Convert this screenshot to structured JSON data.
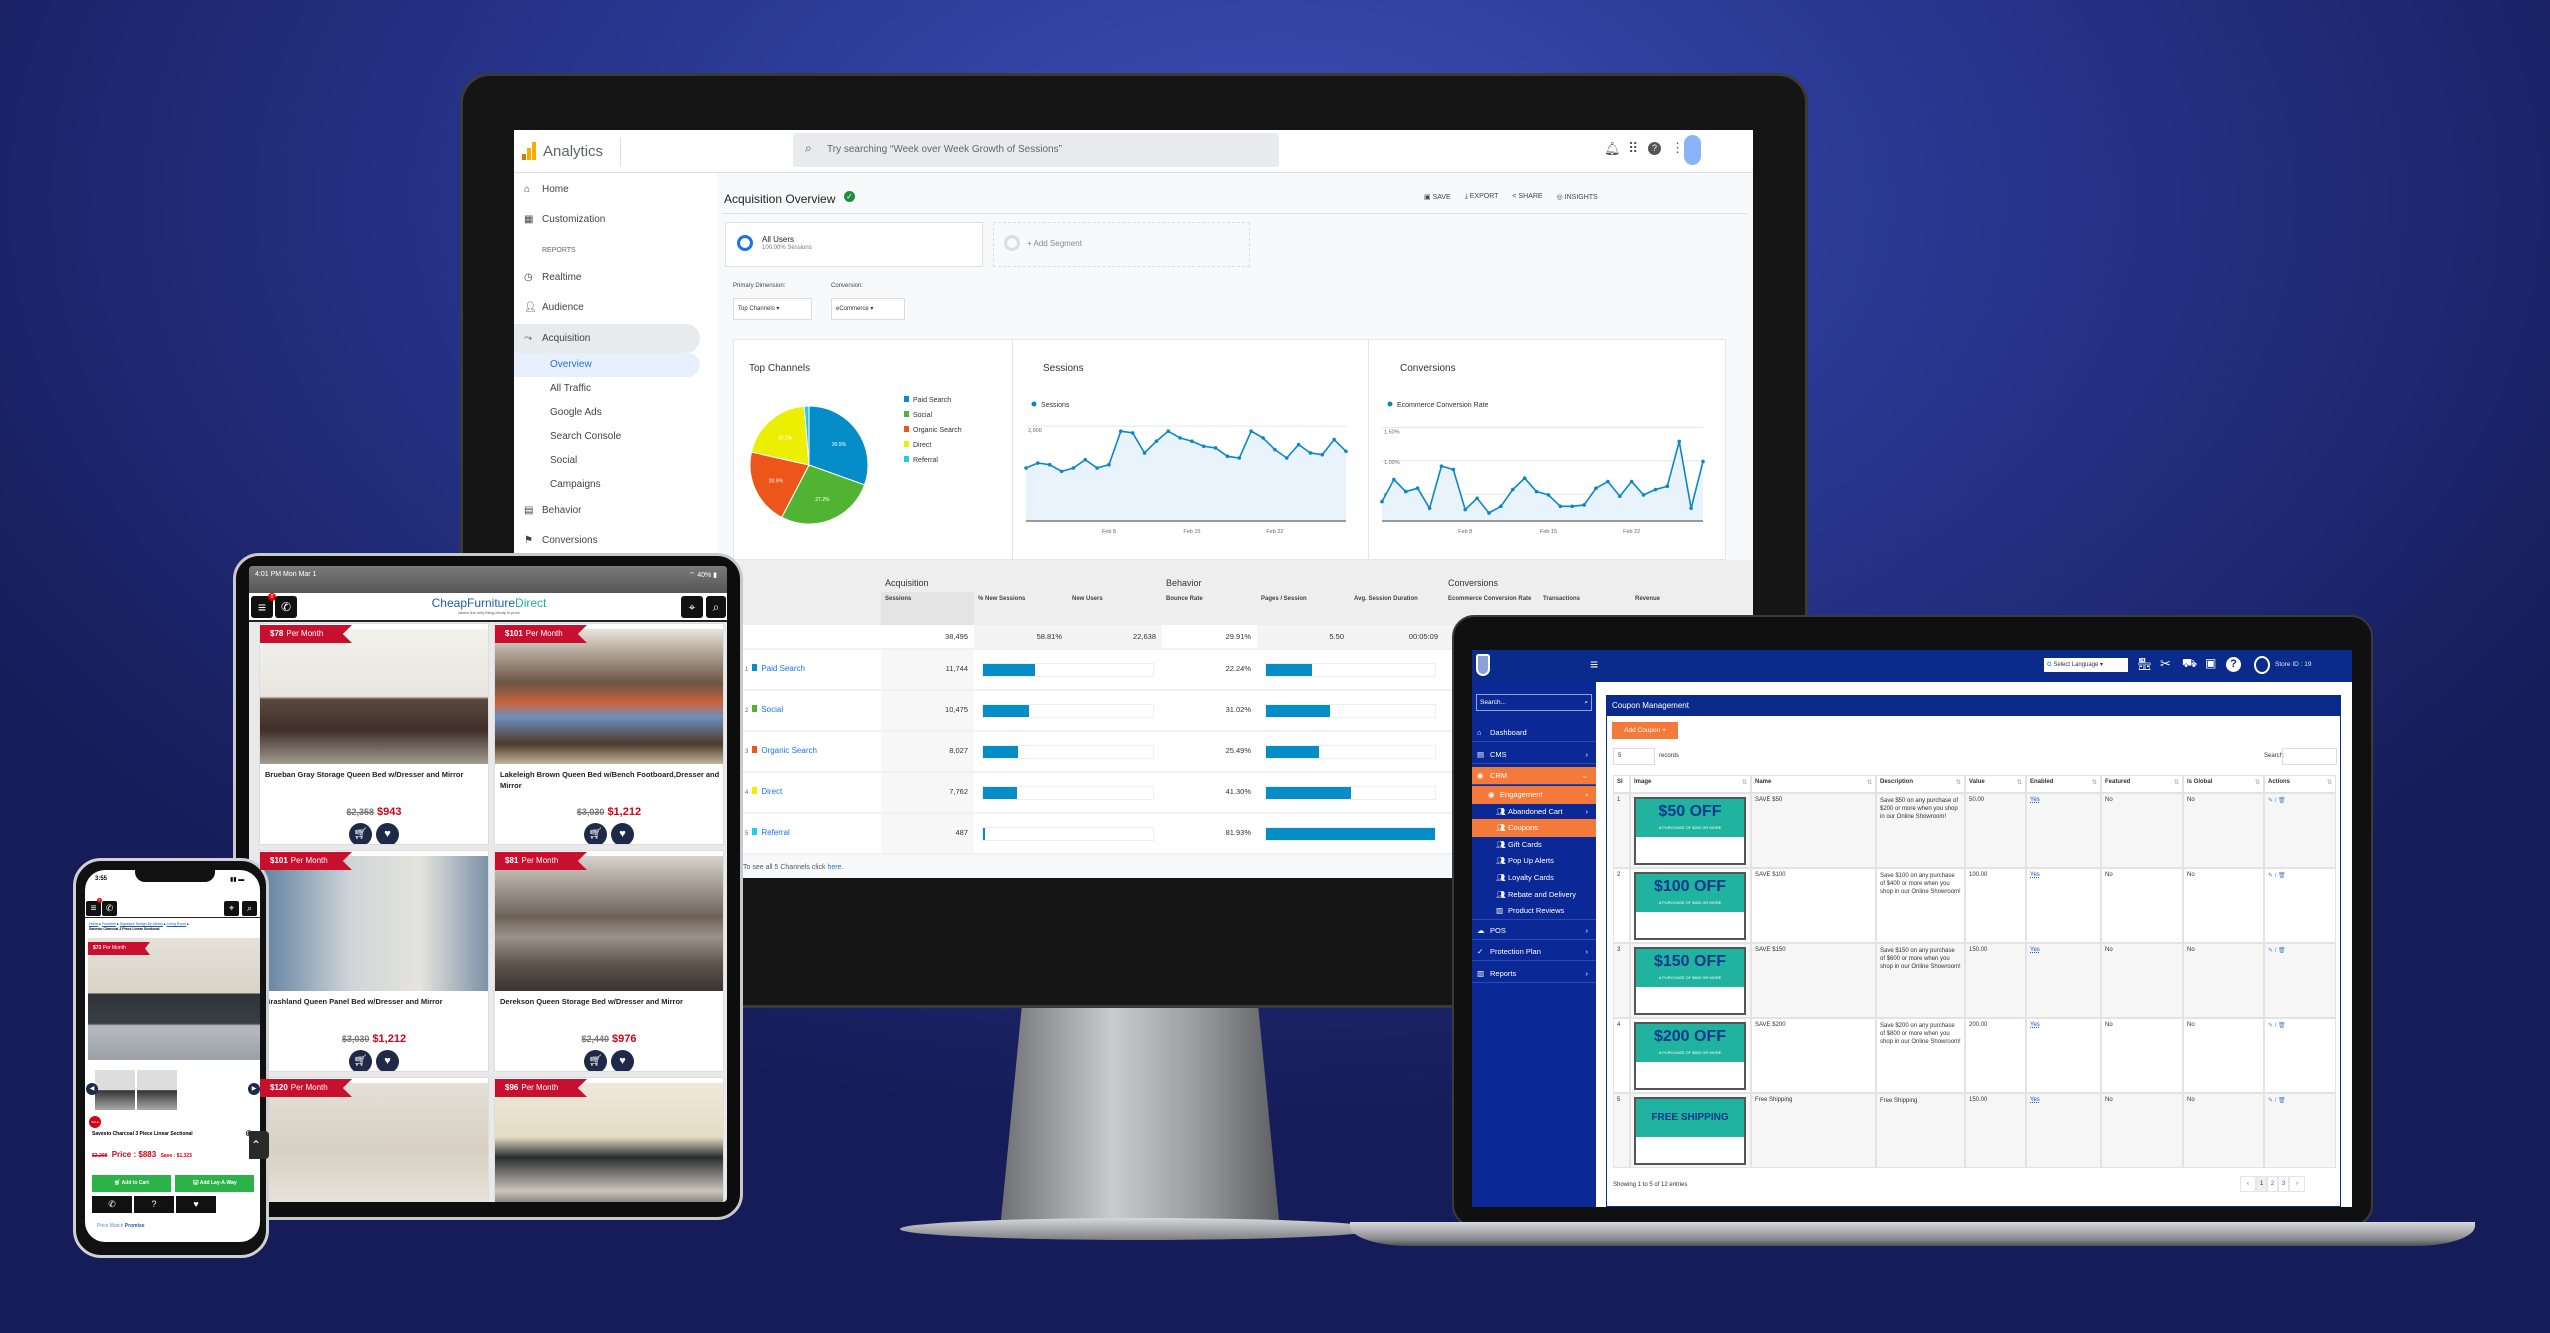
{
  "analytics": {
    "app_name": "Analytics",
    "search_placeholder": "Try searching “Week over Week Growth of Sessions”",
    "sidebar": {
      "home": "Home",
      "customization": "Customization",
      "reports_header": "REPORTS",
      "realtime": "Realtime",
      "audience": "Audience",
      "acquisition": "Acquisition",
      "overview": "Overview",
      "all_traffic": "All Traffic",
      "google_ads": "Google Ads",
      "search_console": "Search Console",
      "social": "Social",
      "campaigns": "Campaigns",
      "behavior": "Behavior",
      "conversions": "Conversions"
    },
    "page_title": "Acquisition Overview",
    "actions": {
      "save": "SAVE",
      "export": "EXPORT",
      "share": "SHARE",
      "insights": "INSIGHTS"
    },
    "segments": {
      "all_users": "All Users",
      "all_users_sub": "100.00% Sessions",
      "add_segment": "+ Add Segment"
    },
    "primary_dimension_label": "Primary Dimension:",
    "primary_dimension_value": "Top Channels",
    "conversion_label": "Conversion:",
    "conversion_value": "eCommerce",
    "panels": {
      "top_channels": "Top Channels",
      "sessions": "Sessions",
      "conversions": "Conversions"
    },
    "colors": {
      "paid_search": "#058dc7",
      "social": "#50b432",
      "organic_search": "#ed561b",
      "direct": "#edef00",
      "referral": "#24cbe5",
      "line": "#0b87c9"
    },
    "table": {
      "groups": [
        "Acquisition",
        "Behavior",
        "Conversions"
      ],
      "columns": [
        "Sessions",
        "% New Sessions",
        "New Users",
        "Bounce Rate",
        "Pages / Session",
        "Avg. Session Duration",
        "Ecommerce Conversion Rate",
        "Transactions",
        "Revenue"
      ],
      "totals": {
        "sessions": "38,495",
        "new_sessions": "58.81%",
        "new_users": "22,638",
        "bounce_rate": "29.91%",
        "pages_session": "5.50",
        "avg_duration": "00:05:09"
      },
      "rows": [
        {
          "num": "1",
          "channel": "Paid Search",
          "sessions": "11,744",
          "bounce_rate": "22.24%"
        },
        {
          "num": "2",
          "channel": "Social",
          "sessions": "10,475",
          "bounce_rate": "31.02%"
        },
        {
          "num": "3",
          "channel": "Organic Search",
          "sessions": "8,027",
          "bounce_rate": "25.49%"
        },
        {
          "num": "4",
          "channel": "Direct",
          "sessions": "7,762",
          "bounce_rate": "41.30%"
        },
        {
          "num": "5",
          "channel": "Referral",
          "sessions": "487",
          "bounce_rate": "81.93%"
        }
      ],
      "footer_text": "To see all 5 Channels click ",
      "footer_link": "here."
    }
  },
  "chart_data": [
    {
      "type": "pie",
      "title": "Top Channels",
      "categories": [
        "Paid Search",
        "Social",
        "Organic Search",
        "Direct",
        "Referral"
      ],
      "values": [
        30.5,
        27.2,
        20.9,
        20.2,
        1.3
      ],
      "data_labels": [
        "30.5%",
        "27.2%",
        "20.9%",
        "20.2%",
        ""
      ],
      "legend": "right"
    },
    {
      "type": "area",
      "title": "Sessions",
      "series": [
        {
          "name": "Sessions",
          "values": [
            1183,
            1281,
            1248,
            1118,
            1183,
            1346,
            1183,
            1248,
            1902,
            1869,
            1477,
            1706,
            1902,
            1771,
            1706,
            1608,
            1575,
            1412,
            1379,
            1902,
            1771,
            1542,
            1379,
            1641,
            1477,
            1444,
            1739,
            1510
          ]
        }
      ],
      "x": [
        "Feb 1",
        "Feb 2",
        "Feb 3",
        "Feb 4",
        "Feb 5",
        "Feb 6",
        "Feb 7",
        "Feb 8",
        "Feb 9",
        "Feb 10",
        "Feb 11",
        "Feb 12",
        "Feb 13",
        "Feb 14",
        "Feb 15",
        "Feb 16",
        "Feb 17",
        "Feb 18",
        "Feb 19",
        "Feb 20",
        "Feb 21",
        "Feb 22",
        "Feb 23",
        "Feb 24",
        "Feb 25",
        "Feb 26",
        "Feb 27",
        "Feb 28"
      ],
      "xticks": [
        "Feb 8",
        "Feb 15",
        "Feb 22"
      ],
      "yticks": [
        "2,000",
        "1,000"
      ],
      "ylim": [
        150,
        2120
      ],
      "grid": true,
      "legend": "top-left"
    },
    {
      "type": "area",
      "title": "Conversions",
      "series": [
        {
          "name": "Ecommerce Conversion Rate",
          "values": [
            0.39,
            0.72,
            0.54,
            0.59,
            0.29,
            0.92,
            0.87,
            0.27,
            0.44,
            0.22,
            0.32,
            0.57,
            0.74,
            0.54,
            0.49,
            0.32,
            0.32,
            0.34,
            0.59,
            0.69,
            0.47,
            0.69,
            0.49,
            0.57,
            0.62,
            1.29,
            0.29,
            0.99
          ]
        }
      ],
      "x": [
        "Feb 1",
        "Feb 2",
        "Feb 3",
        "Feb 4",
        "Feb 5",
        "Feb 6",
        "Feb 7",
        "Feb 8",
        "Feb 9",
        "Feb 10",
        "Feb 11",
        "Feb 12",
        "Feb 13",
        "Feb 14",
        "Feb 15",
        "Feb 16",
        "Feb 17",
        "Feb 18",
        "Feb 19",
        "Feb 20",
        "Feb 21",
        "Feb 22",
        "Feb 23",
        "Feb 24",
        "Feb 25",
        "Feb 26",
        "Feb 27",
        "Feb 28"
      ],
      "xticks": [
        "Feb 8",
        "Feb 15",
        "Feb 22"
      ],
      "yticks": [
        "1.50%",
        "1.00%",
        "0.50%"
      ],
      "ylim": [
        0.1,
        1.61
      ],
      "grid": true,
      "legend": "top-left"
    }
  ],
  "tablet": {
    "status_time": "4:01 PM   Mon Mar 1",
    "status_battery": "40%",
    "cart_badge": "0",
    "logo_main": "Cheap",
    "logo_mid": "Furniture",
    "logo_end": "Direct",
    "logo_tagline": "where the only thing cheap is price",
    "products": [
      {
        "monthly": "$78",
        "per": "Per Month",
        "name": "Brueban Gray Storage Queen Bed w/Dresser and Mirror",
        "old_price": "$2,358",
        "price": "$943"
      },
      {
        "monthly": "$101",
        "per": "Per Month",
        "name": "Lakeleigh Brown Queen Bed w/Bench Footboard,Dresser and Mirror",
        "old_price": "$3,030",
        "price": "$1,212"
      },
      {
        "monthly": "$101",
        "per": "Per Month",
        "name": "Brashland Queen Panel Bed w/Dresser and Mirror",
        "old_price": "$3,030",
        "price": "$1,212"
      },
      {
        "monthly": "$81",
        "per": "Per Month",
        "name": "Derekson Queen Storage Bed w/Dresser and Mirror",
        "old_price": "$2,440",
        "price": "$976"
      },
      {
        "monthly": "$120",
        "per": "Per Month"
      },
      {
        "monthly": "$96",
        "per": "Per Month"
      }
    ]
  },
  "phone": {
    "status_time": "3:55",
    "cart_badge": "0",
    "breadcrumb": [
      "Home",
      "Furniture",
      "Signature Design By Ashley",
      "Living Room"
    ],
    "breadcrumb_current": "Savesto Charcoal 3 Piece Linear Sectional",
    "monthly": "$73",
    "per": "Per Month",
    "sale_badge": "SALE",
    "product_name": "Savesto Charcoal 3 Piece Linear Sectional",
    "old_price": "$2,208",
    "price": "Price : $883",
    "save": "Save : $1,325",
    "add_to_cart": "Add to Cart",
    "add_layaway": "Add Lay-A-Way",
    "help_symbol": "?",
    "price_match_1": "Price Match ",
    "price_match_2": "Promise"
  },
  "pos": {
    "language": "Select Language",
    "store_id": "Store ID : 19",
    "sidebar": {
      "search_placeholder": "Search...",
      "dashboard": "Dashboard",
      "cms": "CMS",
      "crm": "CRM",
      "engagement": "Engagement",
      "abandoned_cart": "Abandoned Cart",
      "coupons": "Coupons",
      "gift_cards": "Gift Cards",
      "pop_up_alerts": "Pop Up Alerts",
      "loyalty_cards": "Loyalty Cards",
      "rebate_delivery": "Rebate and Delivery",
      "product_reviews": "Product Reviews",
      "pos": "POS",
      "protection_plan": "Protection Plan",
      "reports": "Reports"
    },
    "panel_title": "Coupon Management",
    "add_coupon": "Add Coupon +",
    "page_length": "5",
    "records_label": "records",
    "search_label": "Search:",
    "colors": {
      "nav": "#0a2a8c",
      "accent": "#f47a3a"
    },
    "columns": [
      "Sl",
      "Image",
      "Name",
      "Description",
      "Value",
      "Enabled",
      "Featured",
      "Is Global",
      "Actions"
    ],
    "rows": [
      {
        "sl": "1",
        "coupon_big": "$50 OFF",
        "coupon_small": "A PURCHASE OF $200 OR MORE",
        "name": "SAVE $50",
        "description": "Save $50 on any purchase of $200 or more when you shop in our Online Showroom!",
        "value": "50.00",
        "enabled": "Yes",
        "featured": "No",
        "global": "No"
      },
      {
        "sl": "2",
        "coupon_big": "$100 OFF",
        "coupon_small": "A PURCHASE OF $400 OR MORE",
        "name": "SAVE $100",
        "description": "Save $100 on any purchase of $400 or more when you shop in our Online Showroom!",
        "value": "100.00",
        "enabled": "Yes",
        "featured": "No",
        "global": "No"
      },
      {
        "sl": "3",
        "coupon_big": "$150 OFF",
        "coupon_small": "A PURCHASE OF $600 OR MORE",
        "name": "SAVE $150",
        "description": "Save $150 on any purchase of $600 or more when you shop in our Online Showroom!",
        "value": "150.00",
        "enabled": "Yes",
        "featured": "No",
        "global": "No"
      },
      {
        "sl": "4",
        "coupon_big": "$200 OFF",
        "coupon_small": "A PURCHASE OF $800 OR MORE",
        "name": "SAVE $200",
        "description": "Save $200 on any purchase of $800 or more when you shop in our Online Showroom!",
        "value": "200.00",
        "enabled": "Yes",
        "featured": "No",
        "global": "No"
      },
      {
        "sl": "5",
        "coupon_big": "FREE SHIPPING",
        "coupon_small": "",
        "name": "Free Shipping",
        "description": "Free Shipping",
        "value": "150.00",
        "enabled": "Yes",
        "featured": "No",
        "global": "No"
      }
    ],
    "showing": "Showing 1 to 5 of 12 entries",
    "pagination": [
      "‹",
      "1",
      "2",
      "3",
      "›"
    ]
  }
}
